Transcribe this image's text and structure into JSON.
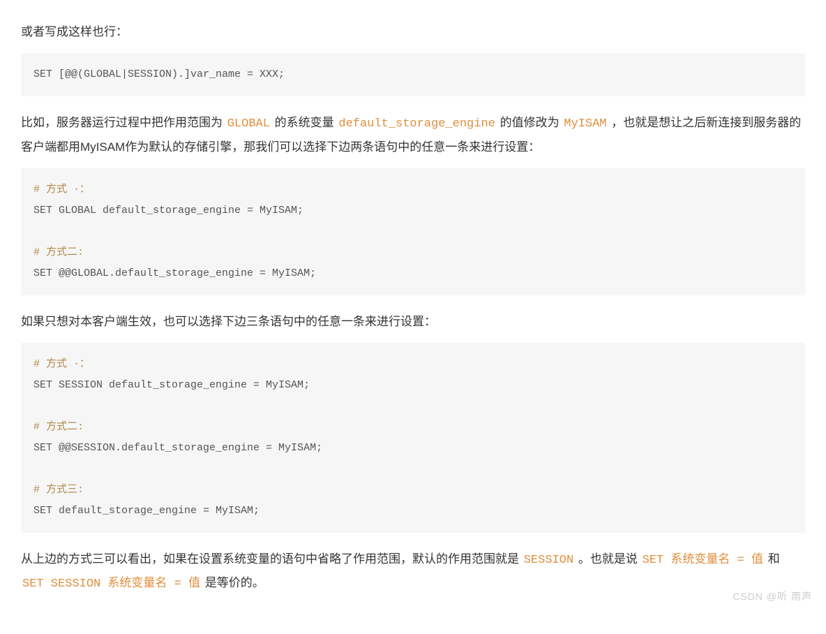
{
  "p1": "或者写成这样也行：",
  "code1": "SET [@@(GLOBAL|SESSION).]var_name = XXX;",
  "p2_a": "比如，服务器运行过程中把作用范围为 ",
  "p2_global": "GLOBAL",
  "p2_b": " 的系统变量 ",
  "p2_var": "default_storage_engine",
  "p2_c": " 的值修改为 ",
  "p2_myisam": "MyISAM",
  "p2_d": " ，也就是想让之后新连接到服务器的客户端都用MyISAM作为默认的存储引擎，那我们可以选择下边两条语句中的任意一条来进行设置：",
  "code2_c1": "# 方式 ·：",
  "code2_l1": "SET GLOBAL default_storage_engine = MyISAM;",
  "code2_c2": "# 方式二:",
  "code2_l2": "SET @@GLOBAL.default_storage_engine = MyISAM;",
  "p3": "如果只想对本客户端生效，也可以选择下边三条语句中的任意一条来进行设置：",
  "code3_c1": "# 方式 ·：",
  "code3_l1": "SET SESSION default_storage_engine = MyISAM;",
  "code3_c2": "# 方式二:",
  "code3_l2": "SET @@SESSION.default_storage_engine = MyISAM;",
  "code3_c3": "# 方式三:",
  "code3_l3": "SET default_storage_engine = MyISAM;",
  "p4_a": "从上边的方式三可以看出，如果在设置系统变量的语句中省略了作用范围，默认的作用范围就是 ",
  "p4_session": "SESSION",
  "p4_b": " 。也就是说 ",
  "p4_set1": "SET 系统变量名 = 值",
  "p4_c": " 和 ",
  "p4_set2": "SET SESSION 系统变量名 = 值",
  "p4_d": " 是等价的。",
  "watermark": "CSDN @听 雨声"
}
